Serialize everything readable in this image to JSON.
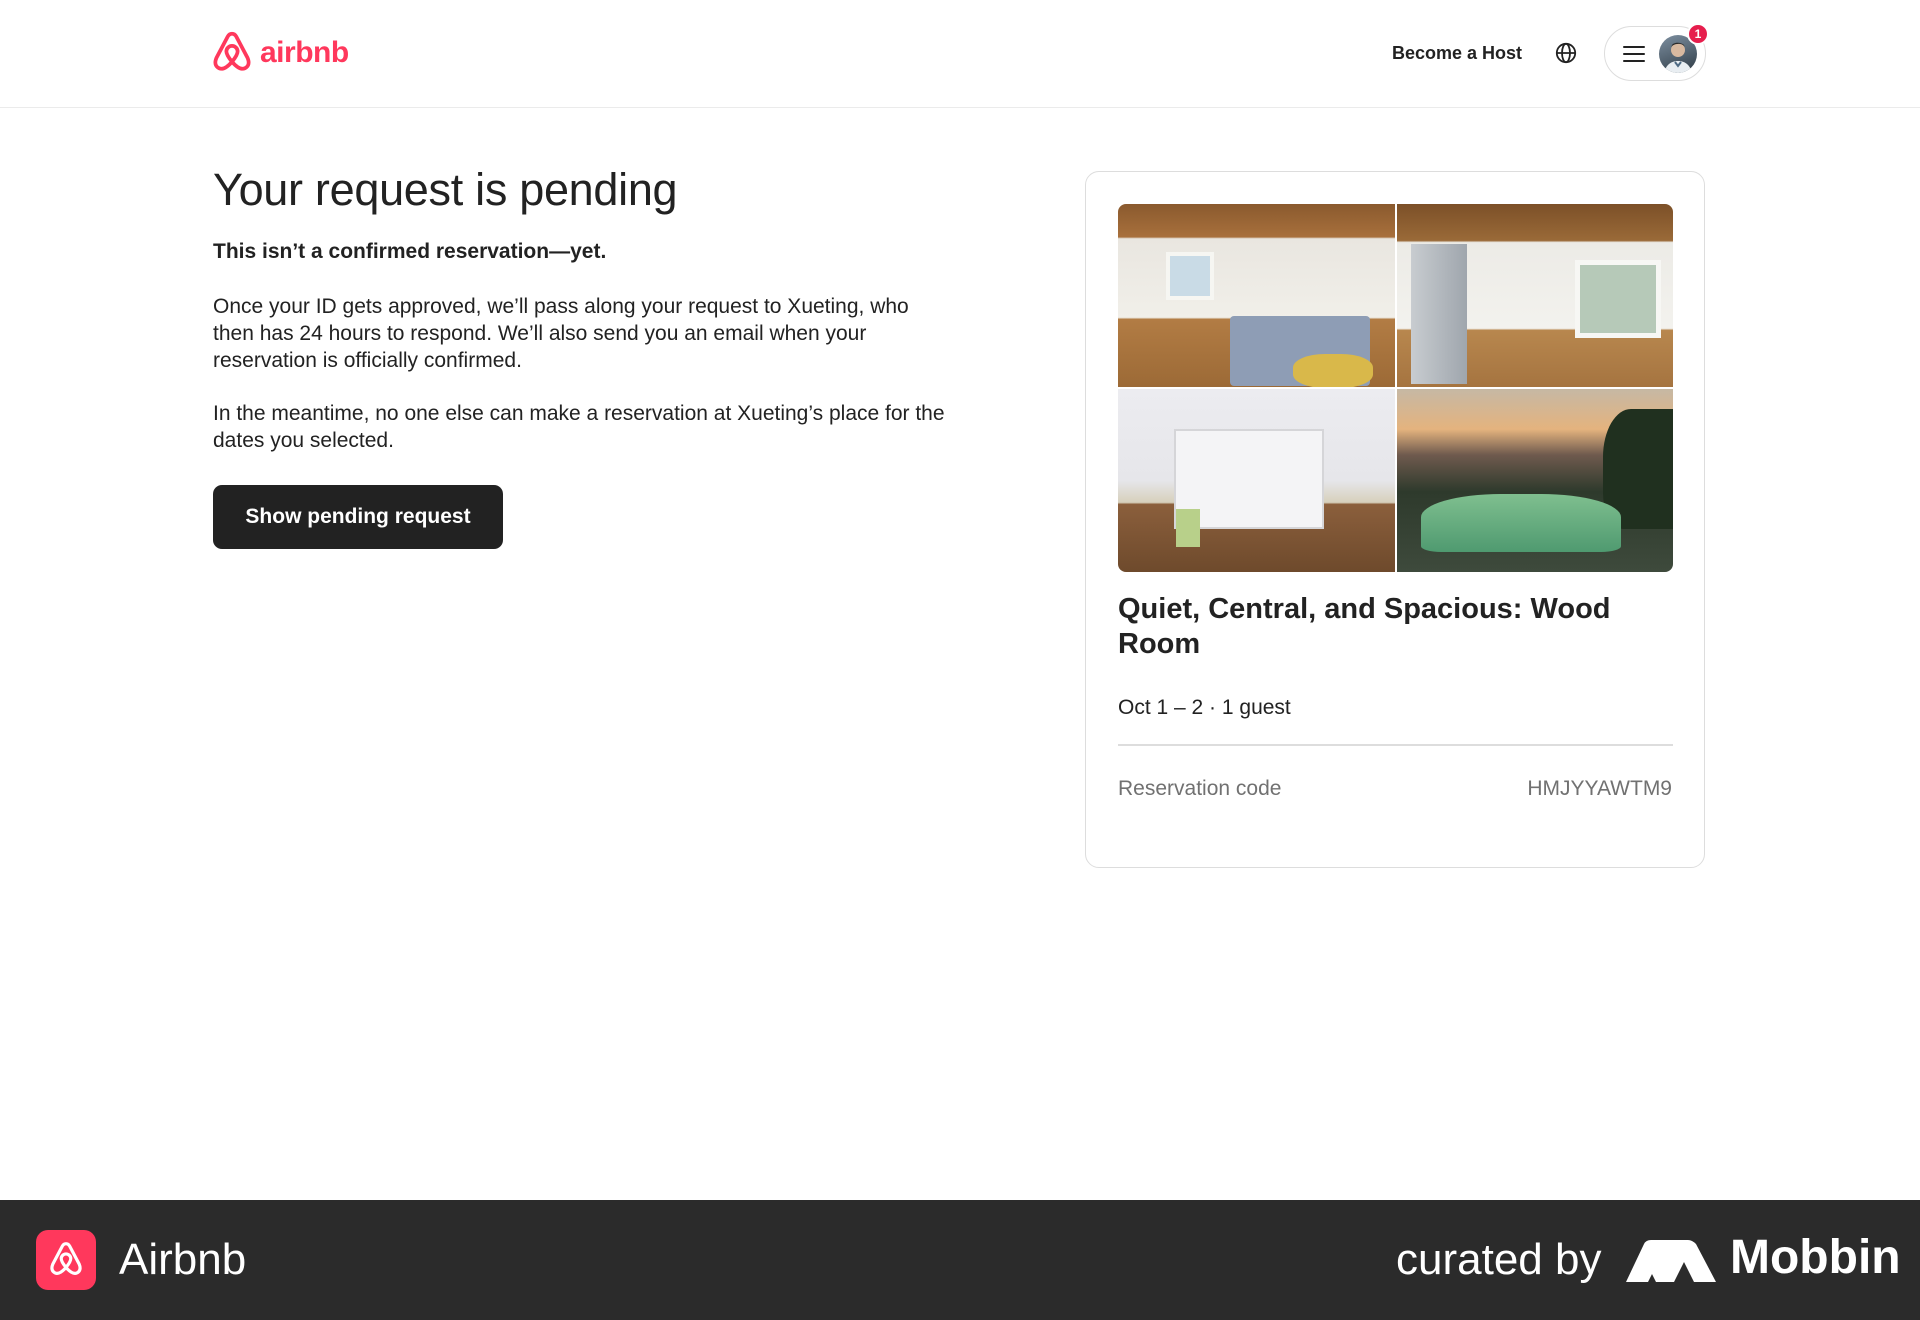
{
  "header": {
    "logo_text": "airbnb",
    "become_host_label": "Become a Host",
    "globe_icon": "globe-icon",
    "menu_icon": "hamburger-menu-icon",
    "notification_count": "1"
  },
  "main": {
    "title": "Your request is pending",
    "subtitle": "This isn’t a confirmed reservation—yet.",
    "paragraph_1": "Once your ID gets approved, we’ll pass along your request to Xueting, who then has 24 hours to respond. We’ll also send you an email when your reservation is officially confirmed.",
    "paragraph_2": "In the meantime, no one else can make a reservation at Xueting’s place for the dates you selected.",
    "button_label": "Show pending request"
  },
  "card": {
    "listing_title": "Quiet, Central, and Spacious: Wood Room",
    "trip_info": "Oct 1 – 2 · 1 guest",
    "reservation_code_label": "Reservation code",
    "reservation_code": "HMJYYAWTM9"
  },
  "banner": {
    "app_name": "Airbnb",
    "curated_by": "curated by",
    "brand": "Mobbin"
  },
  "colors": {
    "brand": "#ff385c",
    "text": "#222222",
    "muted": "#717171",
    "button": "#222222",
    "banner": "#2b2b2b"
  }
}
